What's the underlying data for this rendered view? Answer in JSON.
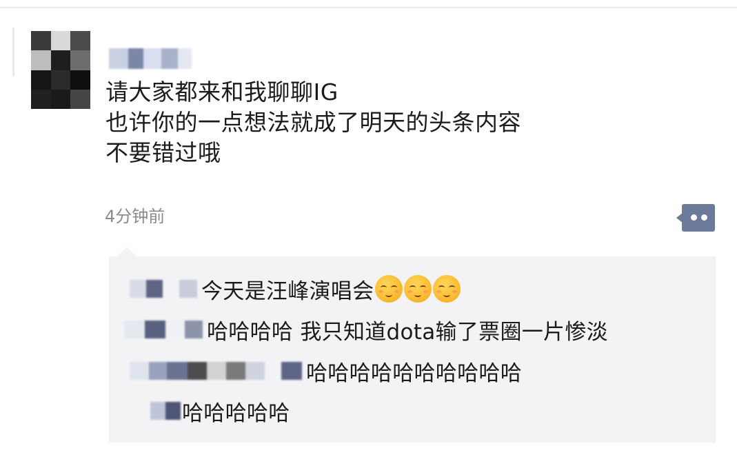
{
  "post": {
    "lines": [
      "请大家都来和我聊聊IG",
      "也许你的一点想法就成了明天的头条内容",
      "不要错过哦"
    ],
    "timestamp": "4分钟前",
    "comment_icon": "comment-bubble-icon"
  },
  "comments": [
    {
      "text": "今天是汪峰演唱会",
      "emoji": [
        "smiling-blush-emoji",
        "smiling-blush-emoji",
        "smiling-blush-emoji"
      ]
    },
    {
      "text": "哈哈哈哈 我只知道dota输了票圈一片惨淡"
    },
    {
      "text": "哈哈哈哈哈哈哈哈哈哈"
    },
    {
      "text": "哈哈哈哈哈"
    }
  ],
  "colors": {
    "comment_button": "#6b7a99",
    "comments_bg": "#f3f3f5",
    "timestamp": "#8a8a8a"
  }
}
